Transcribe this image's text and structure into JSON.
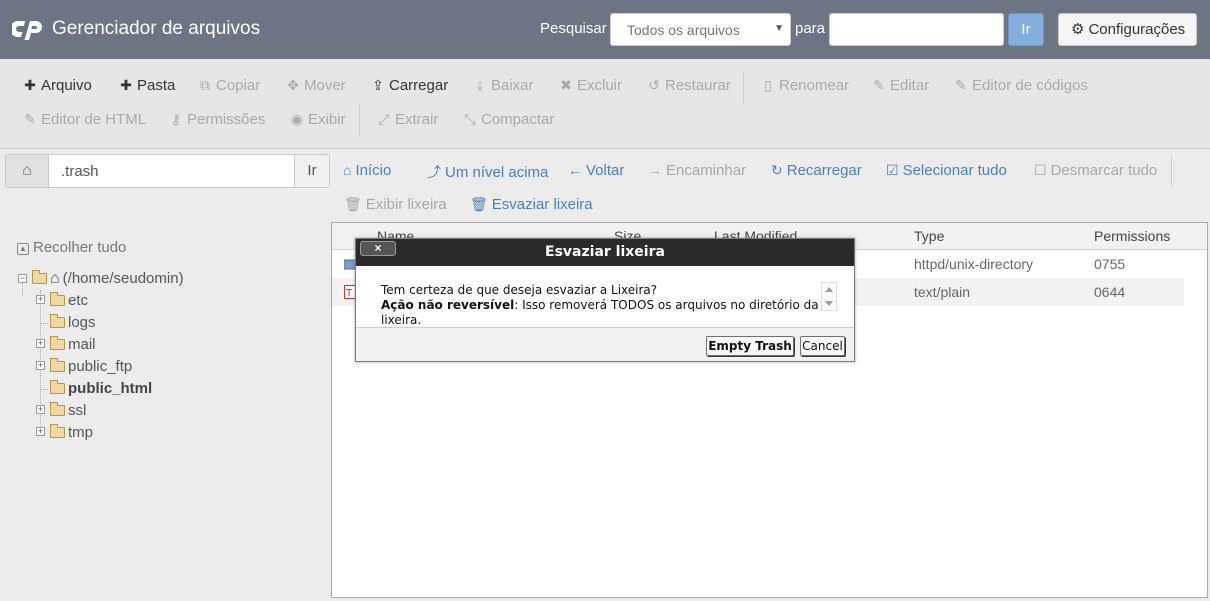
{
  "header": {
    "app_title": "Gerenciador de arquivos",
    "search_label": "Pesquisar",
    "search_scope": "Todos os arquivos",
    "para_label": "para",
    "search_value": "",
    "go_label": "Ir",
    "settings_label": "Configurações"
  },
  "toolbar": {
    "arquivo": "Arquivo",
    "pasta": "Pasta",
    "copiar": "Copiar",
    "mover": "Mover",
    "carregar": "Carregar",
    "baixar": "Baixar",
    "excluir": "Excluir",
    "restaurar": "Restaurar",
    "renomear": "Renomear",
    "editar": "Editar",
    "editor_codigos": "Editor de códigos",
    "editor_html": "Editor de HTML",
    "permissoes": "Permissões",
    "exibir": "Exibir",
    "extrair": "Extrair",
    "compactar": "Compactar"
  },
  "path_bar": {
    "path": ".trash",
    "go_label": "Ir"
  },
  "nav": {
    "inicio": "Início",
    "um_nivel_acima": "Um nível acima",
    "voltar": "Voltar",
    "encaminhar": "Encaminhar",
    "recarregar": "Recarregar",
    "selecionar_tudo": "Selecionar tudo",
    "desmarcar_tudo": "Desmarcar tudo",
    "exibir_lixeira": "Exibir lixeira",
    "esvaziar_lixeira": "Esvaziar lixeira"
  },
  "tree": {
    "collapse_all": "Recolher tudo",
    "root": "(/home/seudomin)",
    "items": [
      {
        "label": "etc",
        "expandable": true,
        "bold": false
      },
      {
        "label": "logs",
        "expandable": false,
        "bold": false
      },
      {
        "label": "mail",
        "expandable": true,
        "bold": false
      },
      {
        "label": "public_ftp",
        "expandable": true,
        "bold": false
      },
      {
        "label": "public_html",
        "expandable": false,
        "bold": true
      },
      {
        "label": "ssl",
        "expandable": true,
        "bold": false
      },
      {
        "label": "tmp",
        "expandable": true,
        "bold": false
      }
    ]
  },
  "file_table": {
    "columns": [
      "Name",
      "Size",
      "Last Modified",
      "Type",
      "Permissions"
    ],
    "rows": [
      {
        "type": "httpd/unix-directory",
        "permissions": "0755"
      },
      {
        "type": "text/plain",
        "permissions": "0644"
      }
    ]
  },
  "modal": {
    "title": "Esvaziar lixeira",
    "close_label": "×",
    "question": "Tem certeza de que deseja esvaziar a Lixeira?",
    "warning_strong": "Ação não reversível",
    "warning_rest": ": Isso removerá TODOS os arquivos no diretório da lixeira.",
    "confirm_label": "Empty Trash",
    "cancel_label": "Cancel"
  },
  "colors": {
    "header_bg": "#6b7584",
    "link_blue": "#4a7fbe",
    "go_button": "#84aede",
    "modal_title_bg": "#2b2b2b"
  }
}
